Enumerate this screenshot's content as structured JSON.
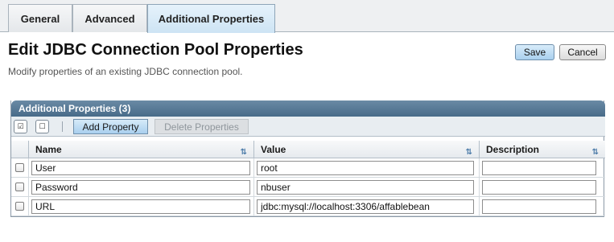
{
  "tabs": [
    {
      "label": "General"
    },
    {
      "label": "Advanced"
    },
    {
      "label": "Additional Properties",
      "active": true
    }
  ],
  "page": {
    "title": "Edit JDBC Connection Pool Properties",
    "description": "Modify properties of an existing JDBC connection pool."
  },
  "actions": {
    "save_label": "Save",
    "cancel_label": "Cancel"
  },
  "table": {
    "title": "Additional Properties (3)",
    "toolbar": {
      "select_all_icon": "select-all-icon",
      "deselect_all_icon": "deselect-all-icon",
      "add_label": "Add Property",
      "delete_label": "Delete Properties"
    },
    "columns": [
      "Name",
      "Value",
      "Description"
    ],
    "rows": [
      {
        "name": "User",
        "value": "root",
        "description": ""
      },
      {
        "name": "Password",
        "value": "nbuser",
        "description": ""
      },
      {
        "name": "URL",
        "value": "jdbc:mysql://localhost:3306/affablebean",
        "description": ""
      }
    ]
  },
  "colors": {
    "header_blue": "#486b89",
    "accent_button": "#a9d0ee",
    "tab_active": "#cde4f4"
  }
}
